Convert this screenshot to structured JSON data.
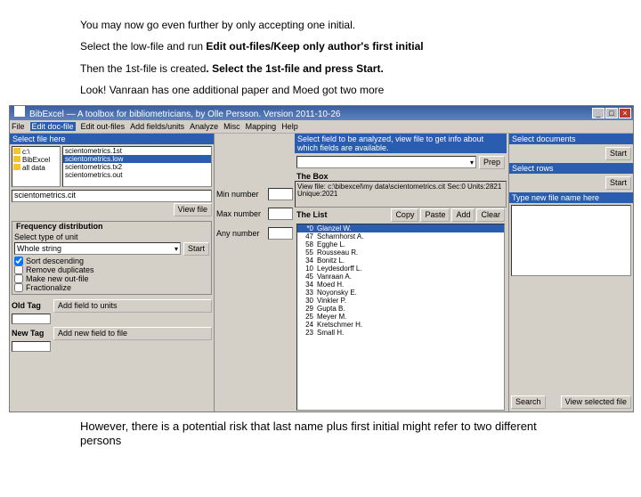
{
  "instructions": {
    "line1": "You may now go even further by only accepting one initial.",
    "line2a": "Select the low-file and run ",
    "line2b": "Edit out-files/Keep only author's first initial",
    "line3a": "Then the 1st-file is created",
    "line3b": ". Select the 1st-file and press Start.",
    "line4": "Look! Vanraan has one additional paper and Moed got two more",
    "footer": "However, there is a potential risk that last name plus first initial might refer to two different persons"
  },
  "title": "BibExcel — A toolbox for bibliometricians, by Olle Persson. Version 2011-10-26",
  "menubar": [
    "File",
    "Edit doc-file",
    "Edit out-files",
    "Add fields/units",
    "Analyze",
    "Misc",
    "Mapping",
    "Help"
  ],
  "menubar_hi": 1,
  "left": {
    "select_file": "Select file here",
    "folders": [
      "c:\\",
      "BibExcel",
      "all data"
    ],
    "files": [
      "scientometrics.1st",
      "scientometrics.low",
      "scientometrics.tx2",
      "scientometrics.out"
    ],
    "file_sel": 1,
    "path": "scientometrics.cit",
    "view_file": "View file",
    "freq_group": "Frequency distribution",
    "unit_label": "Select type of unit",
    "unit_sel": "Whole string",
    "start": "Start",
    "sort_desc": "Sort descending",
    "remove_dup": "Remove duplicates",
    "make_new": "Make new out-file",
    "fractionalize": "Fractionalize",
    "old_tag": "Old Tag",
    "new_tag": "New Tag",
    "add_field": "Add field to units",
    "add_new_field": "Add new field to file",
    "minnum": "Min number",
    "maxnum": "Max number",
    "anynum": "Any number"
  },
  "right": {
    "select_field": "Select field to be analyzed, view file to get info about which fields are available.",
    "prep": "Prep",
    "thebox": "The Box",
    "boxtext": "View file: c:\\bibexcel\\my data\\scientometrics.cit Sec:0 Units:2821 Unique:2021",
    "thelist": "The List",
    "copy": "Copy",
    "paste": "Paste",
    "add": "Add",
    "clear": "Clear",
    "list": [
      {
        "n": "*0",
        "name": "Glanzel W."
      },
      {
        "n": "47",
        "name": "Scharnhorst A."
      },
      {
        "n": "58",
        "name": "Egghe L."
      },
      {
        "n": "55",
        "name": "Rousseau R."
      },
      {
        "n": "34",
        "name": "Bonitz L."
      },
      {
        "n": "10",
        "name": "Leydesdorff L."
      },
      {
        "n": "45",
        "name": "Vanraan A."
      },
      {
        "n": "34",
        "name": "Moed H."
      },
      {
        "n": "33",
        "name": "Noyonsky E."
      },
      {
        "n": "30",
        "name": "Vinkler P."
      },
      {
        "n": "29",
        "name": "Gupta B."
      },
      {
        "n": "25",
        "name": "Meyer M."
      },
      {
        "n": "24",
        "name": "Kretschmer H."
      },
      {
        "n": "23",
        "name": "Small H."
      }
    ],
    "sel_docs": "Select documents",
    "sel_rows": "Select rows",
    "type_new": "Type new file name here",
    "start": "Start",
    "search": "Search",
    "view_sel": "View selected file"
  }
}
